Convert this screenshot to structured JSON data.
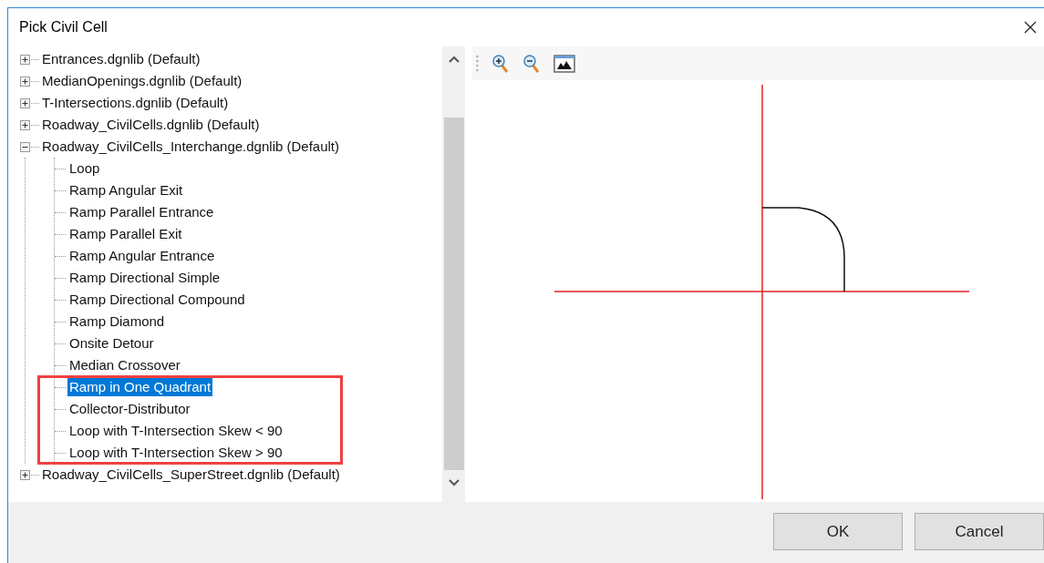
{
  "window": {
    "title": "Pick Civil Cell"
  },
  "tree": {
    "items": [
      {
        "label": "Entrances.dgnlib (Default)",
        "expanded": false,
        "selected": false
      },
      {
        "label": "MedianOpenings.dgnlib (Default)",
        "expanded": false,
        "selected": false
      },
      {
        "label": "T-Intersections.dgnlib (Default)",
        "expanded": false,
        "selected": false
      },
      {
        "label": "Roadway_CivilCells.dgnlib (Default)",
        "expanded": false,
        "selected": false
      },
      {
        "label": "Roadway_CivilCells_Interchange.dgnlib (Default)",
        "expanded": true,
        "selected": false,
        "children": [
          {
            "label": "Loop",
            "selected": false
          },
          {
            "label": "Ramp Angular Exit",
            "selected": false
          },
          {
            "label": "Ramp Parallel Entrance",
            "selected": false
          },
          {
            "label": "Ramp Parallel Exit",
            "selected": false
          },
          {
            "label": "Ramp Angular Entrance",
            "selected": false
          },
          {
            "label": "Ramp Directional Simple",
            "selected": false
          },
          {
            "label": "Ramp Directional Compound",
            "selected": false
          },
          {
            "label": "Ramp Diamond",
            "selected": false
          },
          {
            "label": "Onsite Detour",
            "selected": false
          },
          {
            "label": "Median Crossover",
            "selected": false
          },
          {
            "label": "Ramp in One Quadrant",
            "selected": true
          },
          {
            "label": "Collector-Distributor",
            "selected": false
          },
          {
            "label": "Loop with T-Intersection Skew < 90",
            "selected": false
          },
          {
            "label": "Loop with T-Intersection Skew > 90",
            "selected": false
          }
        ]
      },
      {
        "label": "Roadway_CivilCells_SuperStreet.dgnlib (Default)",
        "expanded": false,
        "selected": false
      }
    ]
  },
  "buttons": [
    "OK",
    "Cancel"
  ]
}
